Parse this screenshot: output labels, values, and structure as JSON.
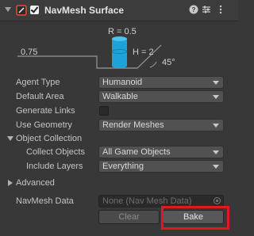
{
  "header": {
    "title": "NavMesh Surface",
    "help_icon": "help-icon",
    "preset_icon": "presets-icon",
    "menu_icon": "kebab-menu-icon"
  },
  "diagram": {
    "radius": "R = 0.5",
    "height": "H = 2",
    "step": "0.75",
    "slope": "45°"
  },
  "fields": {
    "agent_type": {
      "label": "Agent Type",
      "value": "Humanoid"
    },
    "default_area": {
      "label": "Default Area",
      "value": "Walkable"
    },
    "generate_links": {
      "label": "Generate Links"
    },
    "use_geometry": {
      "label": "Use Geometry",
      "value": "Render Meshes"
    }
  },
  "object_collection": {
    "label": "Object Collection",
    "collect_objects": {
      "label": "Collect Objects",
      "value": "All Game Objects"
    },
    "include_layers": {
      "label": "Include Layers",
      "value": "Everything"
    }
  },
  "advanced": {
    "label": "Advanced"
  },
  "navmesh_data": {
    "label": "NavMesh Data",
    "value": "None (Nav Mesh Data)"
  },
  "buttons": {
    "clear": "Clear",
    "bake": "Bake"
  },
  "colors": {
    "agent_cyan": "#1ea3d9",
    "highlight": "#e0191f"
  }
}
